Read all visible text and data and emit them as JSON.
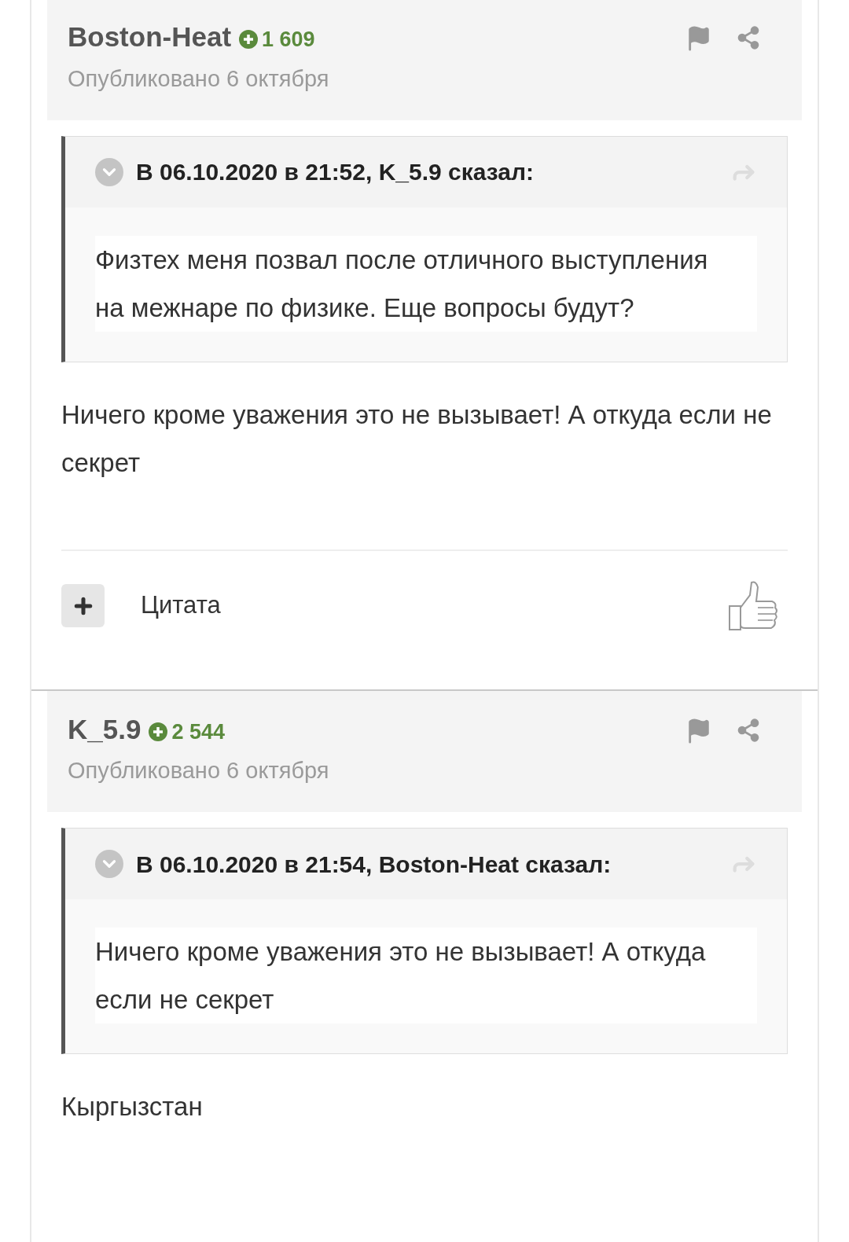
{
  "posts": [
    {
      "author": "Boston-Heat",
      "reputation": "1 609",
      "date": "Опубликовано 6 октября",
      "quote": {
        "header": "В 06.10.2020 в 21:52, K_5.9 сказал:",
        "text": "Физтех меня позвал после отличного выступления на межнаре по физике. Еще вопросы будут?"
      },
      "body": "Ничего кроме уважения это не вызывает! А откуда если не секрет",
      "footer": {
        "quote_label": "Цитата"
      }
    },
    {
      "author": "K_5.9",
      "reputation": "2 544",
      "date": "Опубликовано 6 октября",
      "quote": {
        "header": "В 06.10.2020 в 21:54, Boston-Heat сказал:",
        "text": "Ничего кроме уважения это не вызывает! А откуда если не секрет"
      },
      "body": "Кыргызстан"
    }
  ]
}
